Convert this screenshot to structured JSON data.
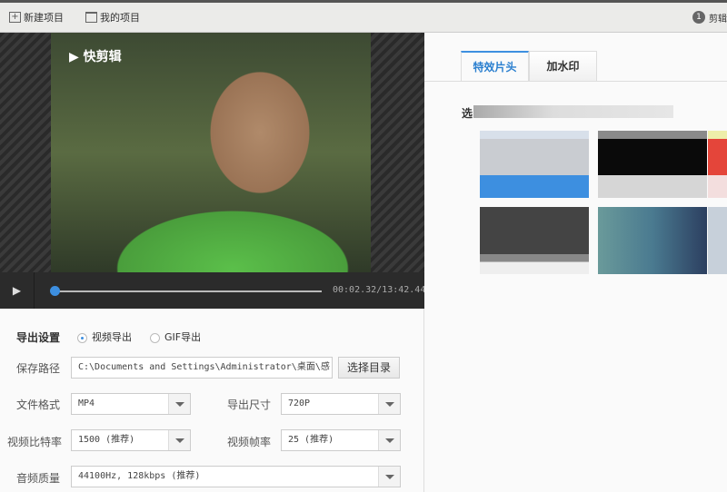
{
  "topbar": {
    "new_project": "新建项目",
    "my_projects": "我的项目",
    "step_number": "1",
    "step_label": "剪辑"
  },
  "player": {
    "logo_text": "快剪辑",
    "current_time": "00:02.32",
    "total_time": "13:42.44",
    "time_display": "00:02.32/13:42.44",
    "progress_percent": 0.3
  },
  "export": {
    "title": "导出设置",
    "mode_options": [
      {
        "label": "视频导出",
        "selected": true
      },
      {
        "label": "GIF导出",
        "selected": false
      }
    ],
    "save_path_label": "保存路径",
    "save_path_value": "C:\\Documents and Settings\\Administrator\\桌面\\感",
    "choose_dir_button": "选择目录",
    "format_label": "文件格式",
    "format_value": "MP4",
    "size_label": "导出尺寸",
    "size_value": "720P",
    "bitrate_label": "视频比特率",
    "bitrate_value": "1500 (推荐)",
    "framerate_label": "视频帧率",
    "framerate_value": "25 (推荐)",
    "audio_label": "音频质量",
    "audio_value": "44100Hz, 128kbps (推荐)"
  },
  "right": {
    "tabs": [
      {
        "label": "特效片头",
        "active": true
      },
      {
        "label": "加水印",
        "active": false
      }
    ],
    "section_label": "选"
  },
  "colors": {
    "accent": "#3d8fe0"
  }
}
